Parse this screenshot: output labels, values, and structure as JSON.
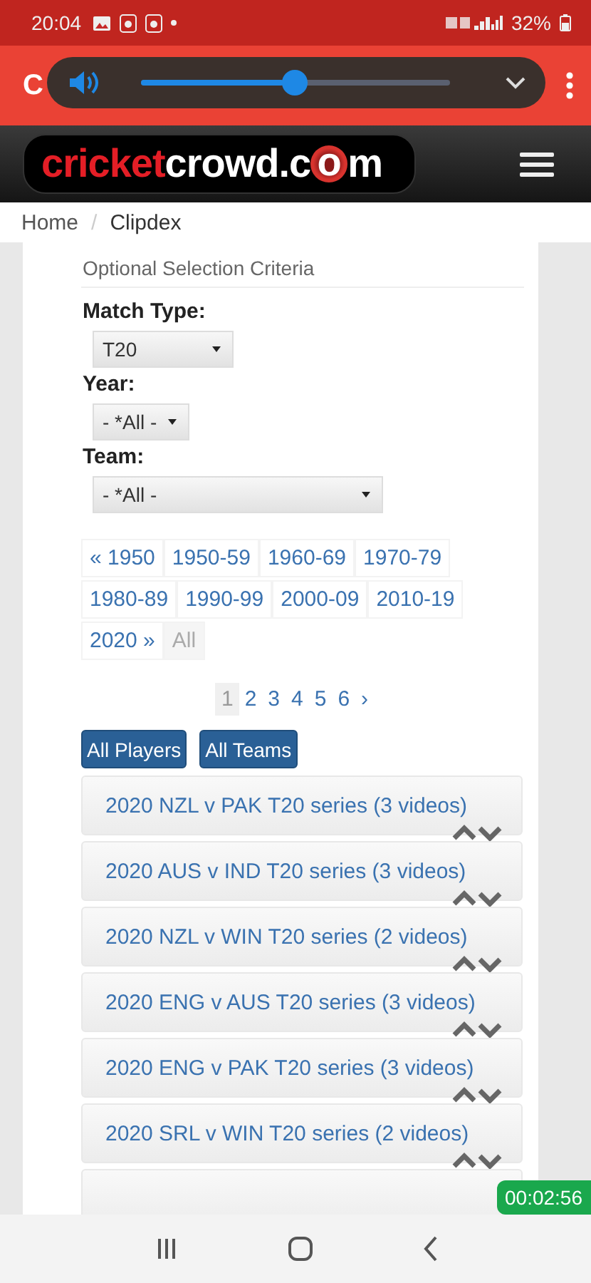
{
  "status_bar": {
    "time": "20:04",
    "battery": "32%"
  },
  "browser": {
    "title": "C",
    "volume": {
      "level": 0.46
    }
  },
  "site": {
    "logo": {
      "brand": "cricket",
      "rest_before": "crowd.c",
      "ball_letter": "o",
      "rest_after": "m"
    }
  },
  "breadcrumb_separator": "/",
  "breadcrumb": [
    {
      "label": "Home",
      "current": false
    },
    {
      "label": "Clipdex",
      "current": true
    }
  ],
  "criteria": {
    "heading": "Optional Selection Criteria",
    "fields": [
      {
        "label": "Match Type:",
        "value": "T20"
      },
      {
        "label": "Year:",
        "value": "- *All -"
      },
      {
        "label": "Team:",
        "value": "- *All -"
      }
    ]
  },
  "year_ranges": [
    {
      "label": "« 1950",
      "selected": false
    },
    {
      "label": "1950-59",
      "selected": false
    },
    {
      "label": "1960-69",
      "selected": false
    },
    {
      "label": "1970-79",
      "selected": false
    },
    {
      "label": "1980-89",
      "selected": false
    },
    {
      "label": "1990-99",
      "selected": false
    },
    {
      "label": "2000-09",
      "selected": false
    },
    {
      "label": "2010-19",
      "selected": false
    },
    {
      "label": "2020 »",
      "selected": false
    },
    {
      "label": "All",
      "selected": true
    }
  ],
  "pages": [
    {
      "label": "1",
      "selected": true
    },
    {
      "label": "2",
      "selected": false
    },
    {
      "label": "3",
      "selected": false
    },
    {
      "label": "4",
      "selected": false
    },
    {
      "label": "5",
      "selected": false
    },
    {
      "label": "6",
      "selected": false
    },
    {
      "label": "›",
      "selected": false
    }
  ],
  "buttons": [
    "All Players",
    "All Teams"
  ],
  "series": [
    {
      "kind": "full",
      "title": "2020 NZL v PAK T20 series (3 videos)"
    },
    {
      "kind": "full",
      "title": "2020 AUS v IND T20 series (3 videos)"
    },
    {
      "kind": "full",
      "title": "2020 NZL v WIN T20 series (2 videos)"
    },
    {
      "kind": "full",
      "title": "2020 ENG v AUS T20 series (3 videos)"
    },
    {
      "kind": "full",
      "title": "2020 ENG v PAK T20 series (3 videos)"
    },
    {
      "kind": "full",
      "title": "2020 SRL v WIN T20 series (2 videos)"
    },
    {
      "kind": "cut_off"
    }
  ],
  "timer": "00:02:56"
}
